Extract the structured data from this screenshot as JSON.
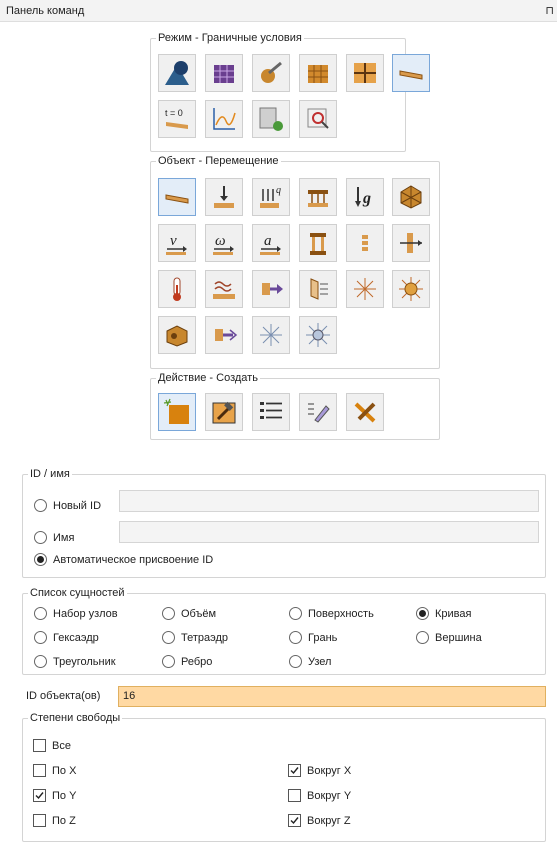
{
  "panel": {
    "title": "Панель команд",
    "pin_icon": "pin-icon"
  },
  "mode": {
    "legend": "Режим - Граничные условия"
  },
  "object": {
    "legend": "Объект - Перемещение"
  },
  "action": {
    "legend": "Действие - Создать"
  },
  "mode_buttons": [
    {
      "name": "geometry-mode-icon"
    },
    {
      "name": "mesh-mode-icon"
    },
    {
      "name": "material-mode-icon"
    },
    {
      "name": "volume-mode-icon"
    },
    {
      "name": "grid-mode-icon"
    },
    {
      "name": "boundary-conditions-icon"
    },
    {
      "name": "initial-conditions-icon",
      "text": "t = 0"
    },
    {
      "name": "graph-icon"
    },
    {
      "name": "calculate-icon"
    },
    {
      "name": "analysis-icon"
    }
  ],
  "id_group": {
    "legend": "ID / имя",
    "new_id": "Новый ID",
    "name": "Имя",
    "auto": "Автоматическое присвоение ID",
    "selected": "auto"
  },
  "entity_list": {
    "legend": "Список сущностей",
    "items": [
      "Набор узлов",
      "Объём",
      "Поверхность",
      "Кривая",
      "Гексаэдр",
      "Тетраэдр",
      "Грань",
      "Вершина",
      "Треугольник",
      "Ребро",
      "Узел"
    ],
    "selected": "Кривая"
  },
  "object_ids": {
    "label": "ID объекта(ов)",
    "value": "16"
  },
  "dof": {
    "legend": "Степени свободы",
    "all": "Все",
    "x": "По X",
    "y": "По Y",
    "z": "По Z",
    "rx": "Вокруг X",
    "ry": "Вокруг Y",
    "rz": "Вокруг Z",
    "checked": [
      "По Y",
      "Вокруг X",
      "Вокруг Z"
    ]
  },
  "colors": {
    "accent": "#ffd9a3",
    "selected_button": "#e3edf8",
    "orange": "#e28a1e"
  }
}
